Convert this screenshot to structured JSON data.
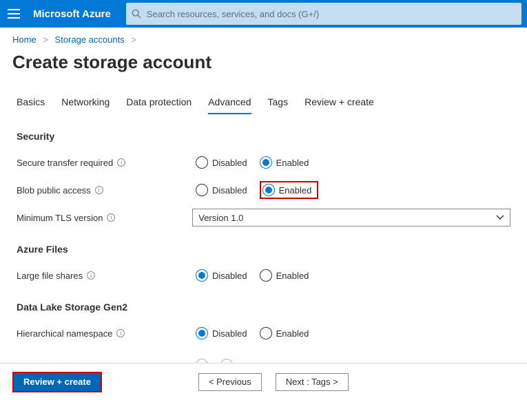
{
  "brand": "Microsoft Azure",
  "search": {
    "placeholder": "Search resources, services, and docs (G+/)"
  },
  "breadcrumbs": {
    "home": "Home",
    "storage": "Storage accounts"
  },
  "page_title": "Create storage account",
  "tabs": {
    "basics": "Basics",
    "networking": "Networking",
    "data_protection": "Data protection",
    "advanced": "Advanced",
    "tags": "Tags",
    "review": "Review + create",
    "active": "advanced"
  },
  "sections": {
    "security": {
      "heading": "Security",
      "secure_transfer": {
        "label": "Secure transfer required",
        "disabled": "Disabled",
        "enabled": "Enabled",
        "value": "Enabled"
      },
      "blob_public": {
        "label": "Blob public access",
        "disabled": "Disabled",
        "enabled": "Enabled",
        "value": "Enabled"
      },
      "tls": {
        "label": "Minimum TLS version",
        "selected": "Version 1.0"
      }
    },
    "azure_files": {
      "heading": "Azure Files",
      "large_shares": {
        "label": "Large file shares",
        "disabled": "Disabled",
        "enabled": "Enabled",
        "value": "Disabled"
      }
    },
    "gen2": {
      "heading": "Data Lake Storage Gen2",
      "hns": {
        "label": "Hierarchical namespace",
        "disabled": "Disabled",
        "enabled": "Enabled",
        "value": "Disabled"
      }
    }
  },
  "footer": {
    "review_create": "Review + create",
    "previous": "<  Previous",
    "next": "Next : Tags  >"
  }
}
